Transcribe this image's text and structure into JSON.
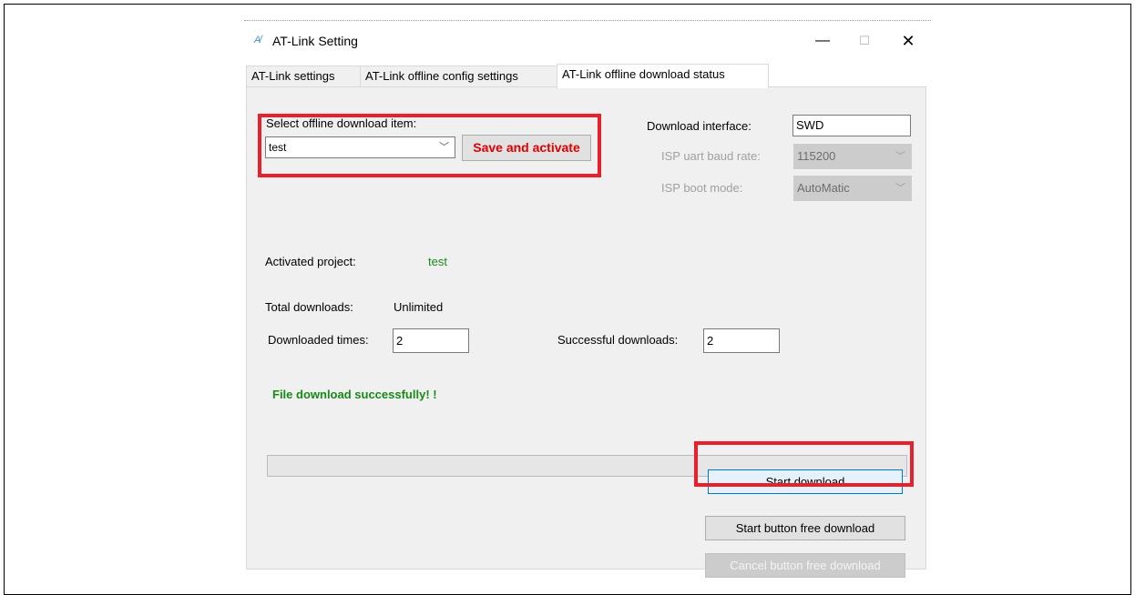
{
  "window": {
    "title": "AT-Link Setting",
    "icon": "app-icon",
    "controls": {
      "minimize": "—",
      "maximize": "☐",
      "close": "✕"
    }
  },
  "tabs": [
    {
      "label": "AT-Link settings",
      "active": false
    },
    {
      "label": "AT-Link offline config settings",
      "active": false
    },
    {
      "label": "AT-Link offline download status",
      "active": true
    }
  ],
  "offline_item": {
    "label": "Select  offline download item:",
    "selected": "test",
    "save_label": "Save and activate"
  },
  "interface": {
    "download_interface_label": "Download interface:",
    "download_interface_value": "SWD",
    "baud_label": "ISP uart baud rate:",
    "baud_value": "115200",
    "boot_label": "ISP boot mode:",
    "boot_value": "AutoMatic"
  },
  "project": {
    "label": "Activated project:",
    "value": "test"
  },
  "stats": {
    "total_label": "Total downloads:",
    "total_value": "Unlimited",
    "downloaded_label": "Downloaded times:",
    "downloaded_value": "2",
    "successful_label": "Successful downloads:",
    "successful_value": "2"
  },
  "status": {
    "message": "File download successfully! !",
    "progress": 0
  },
  "actions": {
    "start_download": "Start download",
    "start_free": "Start button free download",
    "cancel_free": "Cancel button free download"
  },
  "colors": {
    "highlight": "#e8202a",
    "success_green": "#178a17",
    "primary_border": "#0078d7"
  }
}
